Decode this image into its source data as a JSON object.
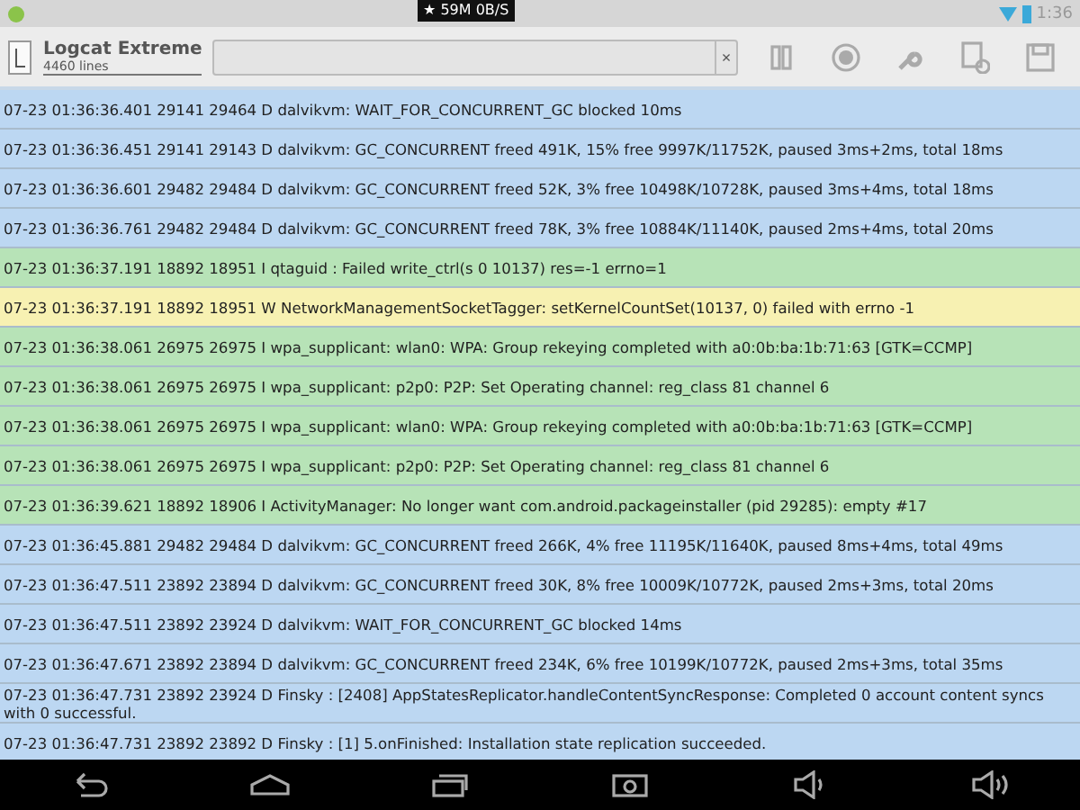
{
  "status_bar": {
    "badge": "★ 59M 0B/S",
    "time": "1:36"
  },
  "action_bar": {
    "title": "Logcat Extreme",
    "subtitle": "4460 lines",
    "filter": {
      "clear": "×"
    }
  },
  "log": [
    {
      "kind": "debug",
      "text": "07-23 01:36:36.401 29141 29464 D dalvikvm: WAIT_FOR_CONCURRENT_GC blocked 10ms"
    },
    {
      "kind": "debug",
      "text": "07-23 01:36:36.451 29141 29143 D dalvikvm: GC_CONCURRENT freed 491K, 15% free 9997K/11752K, paused 3ms+2ms, total 18ms"
    },
    {
      "kind": "debug",
      "text": "07-23 01:36:36.601 29482 29484 D dalvikvm: GC_CONCURRENT freed 52K, 3% free 10498K/10728K, paused 3ms+4ms, total 18ms"
    },
    {
      "kind": "debug",
      "text": "07-23 01:36:36.761 29482 29484 D dalvikvm: GC_CONCURRENT freed 78K, 3% free 10884K/11140K, paused 2ms+4ms, total 20ms"
    },
    {
      "kind": "info",
      "text": "07-23 01:36:37.191 18892 18951 I qtaguid : Failed write_ctrl(s 0 10137) res=-1 errno=1"
    },
    {
      "kind": "warn",
      "text": "07-23 01:36:37.191 18892 18951 W NetworkManagementSocketTagger: setKernelCountSet(10137, 0) failed with errno -1"
    },
    {
      "kind": "info",
      "text": "07-23 01:36:38.061 26975 26975 I wpa_supplicant: wlan0: WPA: Group rekeying completed with a0:0b:ba:1b:71:63 [GTK=CCMP]"
    },
    {
      "kind": "info",
      "text": "07-23 01:36:38.061 26975 26975 I wpa_supplicant: p2p0: P2P: Set Operating channel: reg_class 81 channel 6"
    },
    {
      "kind": "info",
      "text": "07-23 01:36:38.061 26975 26975 I wpa_supplicant: wlan0: WPA: Group rekeying completed with a0:0b:ba:1b:71:63 [GTK=CCMP]"
    },
    {
      "kind": "info",
      "text": "07-23 01:36:38.061 26975 26975 I wpa_supplicant: p2p0: P2P: Set Operating channel: reg_class 81 channel 6"
    },
    {
      "kind": "info",
      "text": "07-23 01:36:39.621 18892 18906 I ActivityManager: No longer want com.android.packageinstaller (pid 29285): empty #17"
    },
    {
      "kind": "debug",
      "text": "07-23 01:36:45.881 29482 29484 D dalvikvm: GC_CONCURRENT freed 266K, 4% free 11195K/11640K, paused 8ms+4ms, total 49ms"
    },
    {
      "kind": "debug",
      "text": "07-23 01:36:47.511 23892 23894 D dalvikvm: GC_CONCURRENT freed 30K, 8% free 10009K/10772K, paused 2ms+3ms, total 20ms"
    },
    {
      "kind": "debug",
      "text": "07-23 01:36:47.511 23892 23924 D dalvikvm: WAIT_FOR_CONCURRENT_GC blocked 14ms"
    },
    {
      "kind": "debug",
      "text": "07-23 01:36:47.671 23892 23894 D dalvikvm: GC_CONCURRENT freed 234K, 6% free 10199K/10772K, paused 2ms+3ms, total 35ms"
    },
    {
      "kind": "debug",
      "text": "07-23 01:36:47.731 23892 23924 D Finsky  : [2408] AppStatesReplicator.handleContentSyncResponse: Completed 0 account content syncs with 0 successful."
    },
    {
      "kind": "debug",
      "text": "07-23 01:36:47.731 23892 23892 D Finsky  : [1] 5.onFinished: Installation state replication succeeded."
    }
  ]
}
